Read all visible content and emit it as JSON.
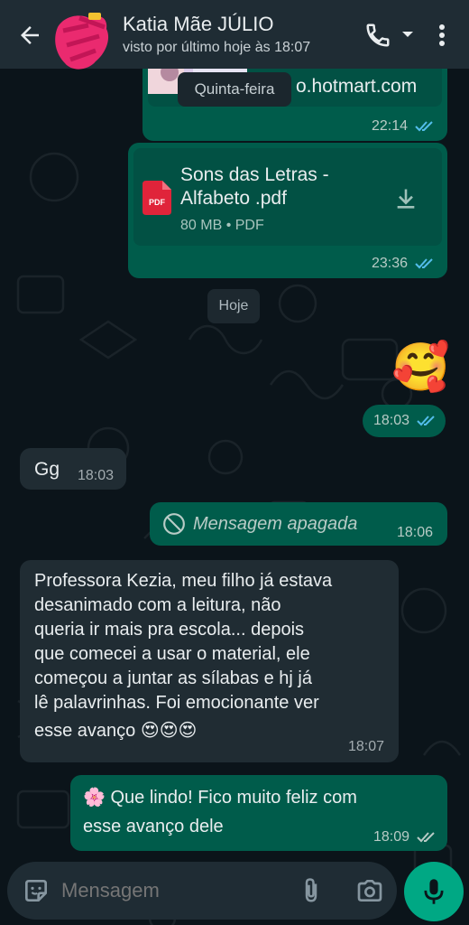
{
  "header": {
    "contact_name": "Katia Mãe JÚLIO",
    "status": "visto por último hoje às 18:07"
  },
  "messages": {
    "link_card": {
      "link_text": "o.hotmart.com",
      "time": "22:14",
      "read": true
    },
    "date_tooltip": "Quinta-feira",
    "document": {
      "file_name": "Sons das Letras - Alfabeto .pdf",
      "file_name_line1": "Sons das Letras -",
      "file_name_line2": "Alfabeto .pdf",
      "file_info": "80 MB • PDF",
      "file_icon_label": "PDF",
      "time": "23:36",
      "read": true
    },
    "date_separator": "Hoje",
    "emoji_message": {
      "emoji": "🥰",
      "time": "18:03",
      "read": true
    },
    "incoming_gg": {
      "text": "Gg",
      "time": "18:03"
    },
    "deleted_message": {
      "text": "Mensagem apagada",
      "time": "18:06"
    },
    "incoming_long": {
      "lines": [
        "Professora Kezia, meu filho já estava",
        "desanimado com a leitura, não",
        "queria ir mais pra escola... depois",
        "que comecei a usar o material, ele",
        "começou a juntar as sílabas e hj já",
        "lê palavrinhas. Foi emocionante ver",
        "esse avanço 😍😍😍"
      ],
      "time": "18:07"
    },
    "outgoing_last": {
      "line1": "🌸 Que lindo! Fico muito feliz com",
      "line2": "esse avanço dele",
      "time": "18:09",
      "read": false
    }
  },
  "composer": {
    "placeholder": "Mensagem"
  },
  "colors": {
    "header_bg": "#1f2c34",
    "chat_bg": "#0b141a",
    "outgoing_bubble": "#005c4b",
    "incoming_bubble": "#202c33",
    "accent": "#00a884",
    "read_tick": "#53bdeb"
  },
  "icons": {
    "back": "arrow-left-icon",
    "call": "phone-icon",
    "dropdown": "caret-down-icon",
    "menu": "more-vertical-icon",
    "download": "download-icon",
    "deleted": "blocked-icon",
    "sticker": "sticker-icon",
    "attach": "paperclip-icon",
    "camera": "camera-icon",
    "mic": "microphone-icon"
  }
}
